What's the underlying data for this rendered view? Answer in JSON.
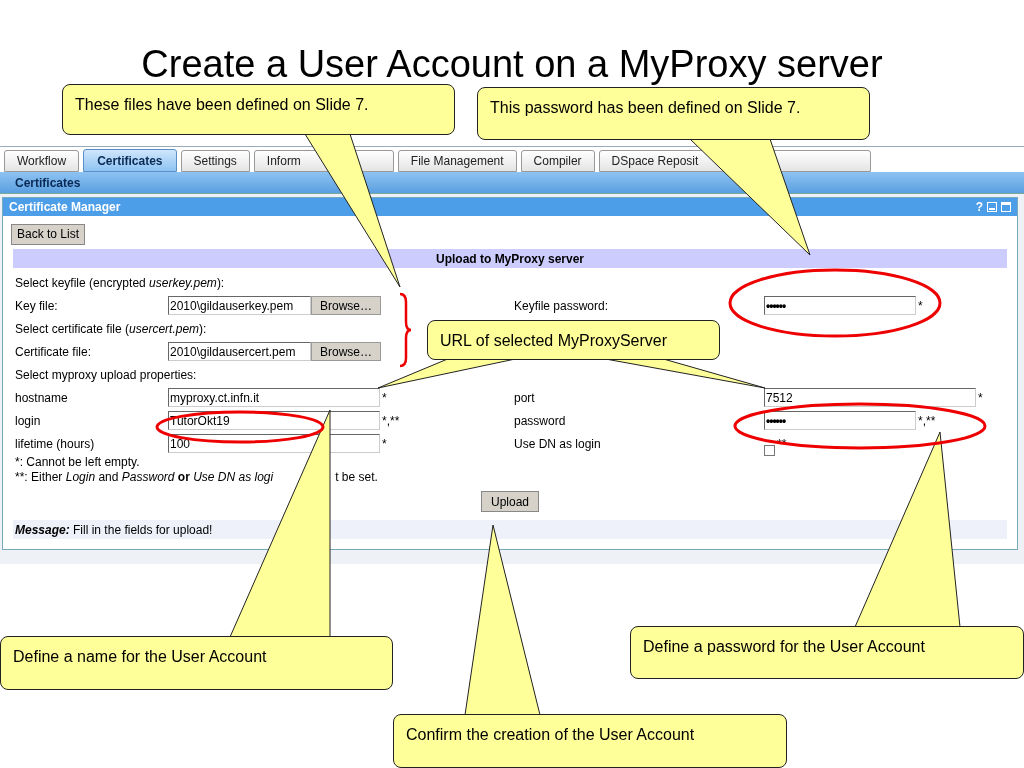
{
  "title": "Create a User Account on a MyProxy server",
  "tabs": [
    {
      "label": "Workflow",
      "selected": false
    },
    {
      "label": "Certificates",
      "selected": true
    },
    {
      "label": "Settings",
      "selected": false
    },
    {
      "label": "Inform",
      "selected": false
    },
    {
      "label": "File Management",
      "selected": false
    },
    {
      "label": "Compiler",
      "selected": false
    },
    {
      "label": "DSpace Reposit",
      "selected": false
    }
  ],
  "section_bar": "Certificates",
  "panel": {
    "title": "Certificate Manager",
    "help": "?"
  },
  "back_button": "Back to List",
  "form": {
    "heading": "Upload to MyProxy server",
    "rows": [
      {
        "kind": "section",
        "text": "Select keyfile (encrypted *userkey.pem*):"
      },
      {
        "kind": "file",
        "label": "Key file:",
        "value": "2010\\gildauserkey.pem",
        "button": "Browse…",
        "right": {
          "kind": "password",
          "label": "Keyfile password:",
          "value": "••••••",
          "suffix": "*"
        }
      },
      {
        "kind": "section",
        "text": "Select certificate file (*usercert.pem*):"
      },
      {
        "kind": "file",
        "label": "Certificate file:",
        "value": "2010\\gildausercert.pem",
        "button": "Browse…"
      },
      {
        "kind": "section",
        "text": "Select myproxy upload properties:"
      },
      {
        "kind": "text",
        "label": "hostname",
        "value": "myproxy.ct.infn.it",
        "suffix": "*",
        "right": {
          "kind": "text",
          "label": "port",
          "value": "7512",
          "suffix": "*"
        }
      },
      {
        "kind": "text",
        "label": "login",
        "value": "TutorOkt19",
        "suffix": "*,**",
        "right": {
          "kind": "password",
          "label": "password",
          "value": "••••••",
          "suffix": "*,**"
        }
      },
      {
        "kind": "text",
        "label": "lifetime (hours)",
        "value": "100",
        "suffix": "*",
        "right": {
          "kind": "checkbox",
          "label": "Use DN as login",
          "checked": false,
          "suffix": "**"
        }
      }
    ]
  },
  "footnotes": [
    {
      "mark": "*:",
      "text": "Cannot be left empty."
    },
    {
      "mark": "**:",
      "text": "Either *Login* and *Password* **or** *Use DN as logi*",
      "after": "t be set."
    }
  ],
  "upload_button": "Upload",
  "message": {
    "label": "Message:",
    "text": "Fill in the fields for upload!"
  },
  "callouts": [
    {
      "text": "These files have been defined on Slide 7."
    },
    {
      "text": "This password has been defined on Slide 7."
    },
    {
      "text": "URL of selected MyProxyServer"
    },
    {
      "text": "Define a name for the User Account"
    },
    {
      "text": "Confirm the creation of the User Account"
    },
    {
      "text": "Define a password for the User Account"
    }
  ]
}
